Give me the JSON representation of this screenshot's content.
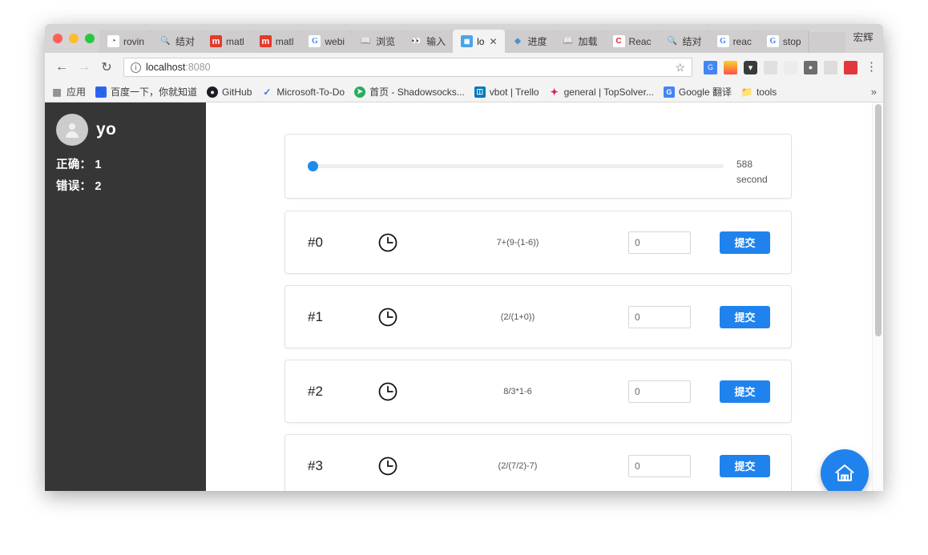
{
  "window": {
    "traffic_lights": [
      "close",
      "minimize",
      "zoom"
    ],
    "profile_label": "宏辉"
  },
  "tabs": [
    {
      "title": "rovin",
      "favicon": "rovio-icon",
      "active": false
    },
    {
      "title": "结对",
      "favicon": "search-icon",
      "active": false
    },
    {
      "title": "matl",
      "favicon": "m-icon",
      "active": false
    },
    {
      "title": "matl",
      "favicon": "m-icon",
      "active": false
    },
    {
      "title": "webi",
      "favicon": "google-icon",
      "active": false
    },
    {
      "title": "浏览",
      "favicon": "book-icon",
      "active": false
    },
    {
      "title": "输入",
      "favicon": "owl-icon",
      "active": false
    },
    {
      "title": "lo",
      "favicon": "app-icon",
      "active": true
    },
    {
      "title": "进度",
      "favicon": "diamond-icon",
      "active": false
    },
    {
      "title": "加载",
      "favicon": "book-icon",
      "active": false
    },
    {
      "title": "Reac",
      "favicon": "c-icon",
      "active": false
    },
    {
      "title": "结对",
      "favicon": "search-icon",
      "active": false
    },
    {
      "title": "reac",
      "favicon": "google-icon",
      "active": false
    },
    {
      "title": "stop",
      "favicon": "google-icon",
      "active": false
    }
  ],
  "toolbar": {
    "back_icon": "back-arrow-icon",
    "forward_icon": "forward-arrow-icon",
    "reload_icon": "reload-icon",
    "info_glyph": "i",
    "url_host": "localhost",
    "url_port": ":8080",
    "star_glyph": "☆",
    "menu_glyph": "⋮",
    "extensions": [
      "google-translate-icon",
      "notes-icon",
      "pocket-icon",
      "grey-extension-icon",
      "ghost-extension-icon",
      "camera-icon",
      "cloud-icon",
      "red-extension-icon"
    ]
  },
  "bookmarks": {
    "items": [
      {
        "label": "应用",
        "icon": "apps-grid-icon"
      },
      {
        "label": "百度一下，你就知道",
        "icon": "baidu-icon"
      },
      {
        "label": "GitHub",
        "icon": "github-icon"
      },
      {
        "label": "Microsoft-To-Do",
        "icon": "checkmark-icon"
      },
      {
        "label": "首页 - Shadowsocks...",
        "icon": "shadowsocks-icon"
      },
      {
        "label": "vbot | Trello",
        "icon": "trello-icon"
      },
      {
        "label": "general | TopSolver...",
        "icon": "slack-icon"
      },
      {
        "label": "Google 翻译",
        "icon": "google-translate-icon"
      },
      {
        "label": "tools",
        "icon": "folder-icon"
      }
    ],
    "overflow_glyph": "»"
  },
  "sidebar": {
    "avatar_icon": "user-avatar-icon",
    "username": "yo",
    "stats": [
      {
        "label": "正确：",
        "value": "1"
      },
      {
        "label": "错误：",
        "value": "2"
      }
    ],
    "correct_line": "正确： 1",
    "wrong_line": "错误： 2"
  },
  "progress": {
    "slider_percent": 1,
    "timer_value": "588",
    "timer_unit": "second",
    "thumb_color": "#1a8cf0"
  },
  "questions": [
    {
      "index": "#0",
      "clock_icon": "clock-icon",
      "expression": "7+(9-(1-6))",
      "answer_value": "0",
      "submit_label": "提交"
    },
    {
      "index": "#1",
      "clock_icon": "clock-icon",
      "expression": "(2/(1+0))",
      "answer_value": "0",
      "submit_label": "提交"
    },
    {
      "index": "#2",
      "clock_icon": "clock-icon",
      "expression": "8/3*1-6",
      "answer_value": "0",
      "submit_label": "提交"
    },
    {
      "index": "#3",
      "clock_icon": "clock-icon",
      "expression": "(2/(7/2)-7)",
      "answer_value": "0",
      "submit_label": "提交"
    }
  ],
  "fab": {
    "icon": "home-icon"
  },
  "colors": {
    "accent_blue": "#2083ed",
    "sidebar_dark": "#363636",
    "page_white": "#ffffff"
  }
}
